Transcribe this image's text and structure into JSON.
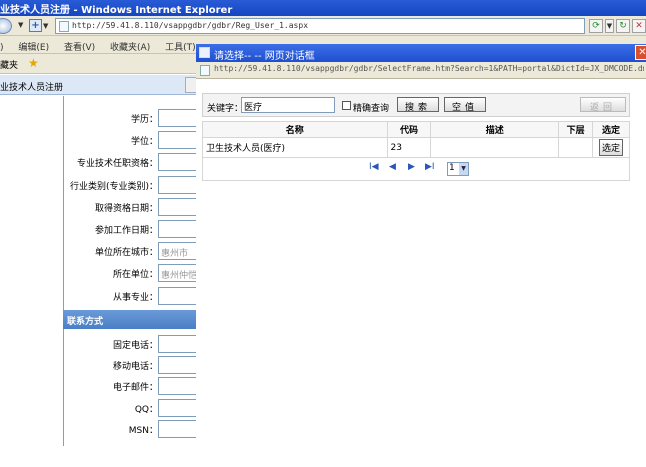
{
  "window": {
    "title": "业技术人员注册 - Windows Internet Explorer",
    "address": "http://59.41.8.110/vsappgdbr/gdbr/Reg_User_1.aspx"
  },
  "menu": {
    "items": [
      "编辑(E)",
      "查看(V)",
      "收藏夹(A)",
      "工具(T)"
    ],
    "partial": ")"
  },
  "favorites": {
    "label": "藏夹"
  },
  "tab": {
    "label": "业技术人员注册"
  },
  "form": {
    "fields": [
      {
        "label": "学历：",
        "value": ""
      },
      {
        "label": "学位：",
        "value": ""
      },
      {
        "label": "专业技术任职资格：",
        "value": ""
      },
      {
        "label": "行业类别(专业类别)：",
        "value": ""
      },
      {
        "label": "取得资格日期：",
        "value": ""
      },
      {
        "label": "参加工作日期：",
        "value": ""
      },
      {
        "label": "单位所在城市：",
        "value": "惠州市"
      },
      {
        "label": "所在单位：",
        "value": "惠州仲恺"
      },
      {
        "label": "从事专业：",
        "value": ""
      }
    ],
    "contact_section": "联系方式",
    "contact_fields": [
      {
        "label": "固定电话：",
        "value": ""
      },
      {
        "label": "移动电话：",
        "value": ""
      },
      {
        "label": "电子邮件：",
        "value": ""
      },
      {
        "label": "QQ：",
        "value": ""
      },
      {
        "label": "MSN：",
        "value": ""
      }
    ]
  },
  "dialog": {
    "title": "请选择--  -- 网页对话框",
    "address": "http://59.41.8.110/vsappgdbr/gdbr/SelectFrame.htm?Search=1&PATH=portal&DictId=JX_DMCODE.dmName.dmcode&M",
    "search": {
      "keyword_label": "关键字：",
      "keyword_value": "医疗",
      "exact_label": "精确查询",
      "search_button": "搜索",
      "clear_button": "空值",
      "back_button": "返回"
    },
    "table": {
      "columns": [
        "名称",
        "代码",
        "描述",
        "下层",
        "选定"
      ],
      "rows": [
        {
          "name": "卫生技术人员(医疗)",
          "code": "23",
          "desc": "",
          "lower": "",
          "select": "选定"
        }
      ]
    },
    "pager": {
      "first": "I◀",
      "prev": "◀",
      "next": "▶",
      "last": "▶I",
      "current_page": "1"
    }
  }
}
